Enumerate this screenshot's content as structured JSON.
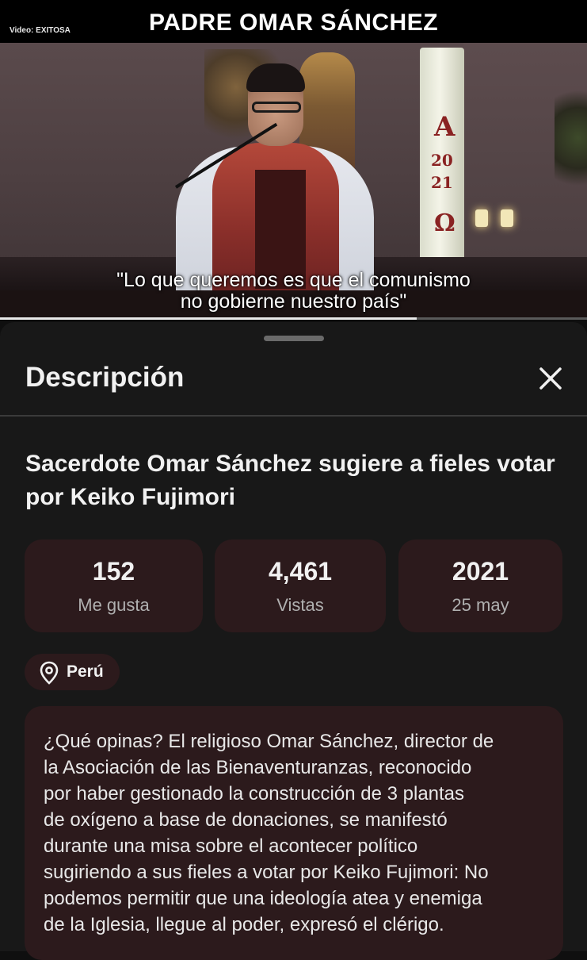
{
  "video": {
    "credit": "Video: EXITOSA",
    "overlay_title": "PADRE OMAR SÁNCHEZ",
    "quote_line1": "\"Lo que queremos es que el comunismo",
    "quote_line2": "no gobierne nuestro país\"",
    "altar_letters": {
      "alpha": "A",
      "year_top": "20",
      "year_bottom": "21",
      "omega": "Ω"
    },
    "progress_fraction": 0.71
  },
  "description_panel": {
    "title": "Descripción",
    "close_icon": "close-icon",
    "video_title": "Sacerdote Omar Sánchez sugiere a fieles votar por Keiko Fujimori",
    "stats": [
      {
        "value": "152",
        "label": "Me gusta"
      },
      {
        "value": "4,461",
        "label": "Vistas"
      },
      {
        "value": "2021",
        "label": "25 may"
      }
    ],
    "location": {
      "icon": "location-pin-icon",
      "label": "Perú"
    },
    "body": "¿Qué opinas? El religioso Omar Sánchez, director de\nla Asociación de las Bienaventuranzas, reconocido\npor haber gestionado la construcción de 3  plantas\nde oxígeno a base de donaciones, se  manifestó\ndurante una misa sobre el acontecer político\nsugiriendo a sus fieles a votar por Keiko Fujimori: No\npodemos permitir que una ideología atea y enemiga\nde la Iglesia, llegue al poder, expresó el clérigo."
  },
  "colors": {
    "sheet_background": "#181818",
    "card_background": "#2c1a1c",
    "text_primary": "#f1f1f1",
    "text_secondary": "#b0b0b0"
  }
}
